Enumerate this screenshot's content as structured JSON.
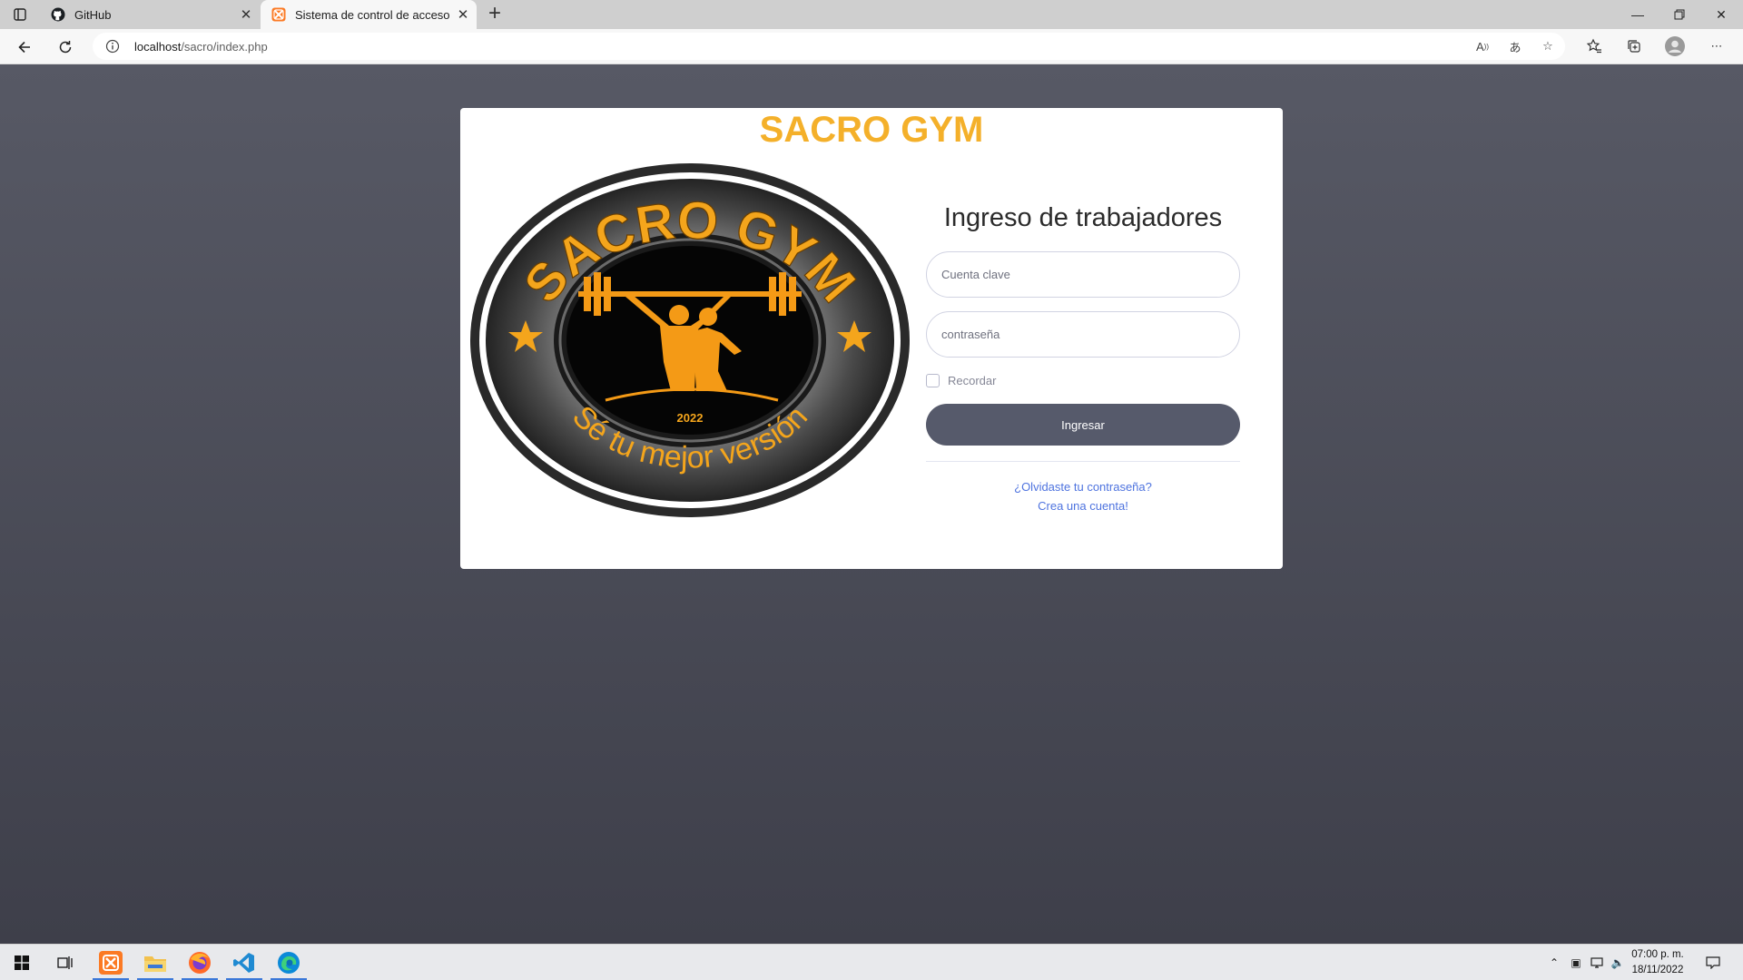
{
  "browser": {
    "tabs": [
      {
        "label": "GitHub",
        "icon": "github-icon"
      },
      {
        "label": "Sistema de control de accesos -",
        "icon": "xampp-icon",
        "active": true
      }
    ],
    "address": {
      "host": "localhost",
      "path": "/sacro/index.php"
    }
  },
  "page": {
    "brand": "SACRO GYM",
    "logo": {
      "ring_text": "SACRO GYM",
      "year": "2022",
      "motto": "Sé tu mejor versión"
    },
    "login": {
      "title": "Ingreso de trabajadores",
      "account_placeholder": "Cuenta clave",
      "password_placeholder": "contraseña",
      "remember_label": "Recordar",
      "submit_label": "Ingresar",
      "forgot_link": "¿Olvidaste tu contraseña?",
      "register_link": "Crea una cuenta!"
    }
  },
  "taskbar": {
    "apps": [
      "windows-start-icon",
      "task-view-icon",
      "xampp-icon",
      "file-explorer-icon",
      "firefox-icon",
      "vscode-icon",
      "edge-icon"
    ],
    "time": "07:00 p. m.",
    "date": "18/11/2022"
  },
  "colors": {
    "brand": "#f4b02a",
    "button": "#565a6b",
    "link": "#4e73df",
    "page_background": "#4b4c58"
  }
}
